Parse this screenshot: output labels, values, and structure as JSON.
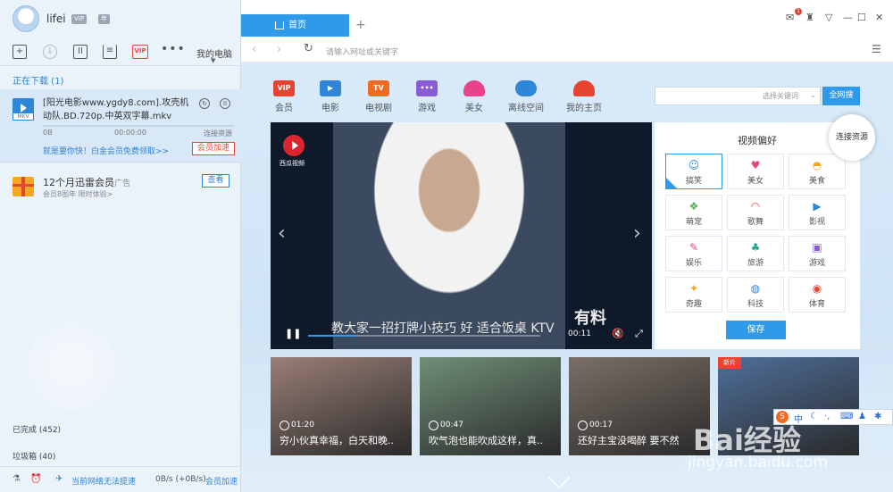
{
  "user": {
    "name": "lifei",
    "badges": [
      "VIP",
      "年"
    ]
  },
  "toolbar": {
    "vip": "VIP",
    "more": "•••",
    "my_pc": "我的电脑"
  },
  "downloads": {
    "header": "正在下载 (1)",
    "task": {
      "file_ext": "MKV",
      "file_name": "[阳光电影www.ygdy8.com].攻壳机动队.BD.720p.中英双字幕.mkv",
      "size": "0B",
      "time": "00:00:00",
      "status": "连接资源",
      "progress": 0,
      "promo": "就是要你快！白金会员免费领取>>",
      "accel_label": "会员加速"
    },
    "ad": {
      "title": "12个月迅雷会员",
      "tag": "- 广告",
      "subtitle": "会员8图年 限时体验>",
      "button": "查看"
    },
    "completed": "已完成 (452)",
    "trash": "垃圾箱 (40)"
  },
  "statusbar": {
    "net_warning": "当前网络无法提速",
    "speed": "0B/s (+0B/s)",
    "vip_speed": "会员加速"
  },
  "browser": {
    "tab_label": "首页",
    "add_tab": "+",
    "notification_count": "1",
    "address_placeholder": "请输入网址或关键字",
    "categories": [
      {
        "label": "会员",
        "icon": "VIP",
        "color": "#e8432f"
      },
      {
        "label": "电影",
        "icon": "▶",
        "color": "#2f85d8"
      },
      {
        "label": "电视剧",
        "icon": "TV",
        "color": "#f06a23"
      },
      {
        "label": "游戏",
        "icon": "•••",
        "color": "#8a5bd6"
      },
      {
        "label": "美女",
        "icon": "",
        "color": "#e8438a"
      },
      {
        "label": "离线空间",
        "icon": "",
        "color": "#2f85d8"
      },
      {
        "label": "我的主页",
        "icon": "",
        "color": "#e8432f"
      }
    ],
    "search": {
      "scope": "选择关键词",
      "button": "全网搜"
    },
    "player": {
      "brand": "西瓜视频",
      "caption": "教大家一招打牌小技巧 好 适合饭桌 KTV",
      "watermark": "有料",
      "time": "00:11",
      "progress": 0.2
    },
    "prefs": {
      "title": "视频偏好",
      "items": [
        {
          "label": "搞笑",
          "icon": "☺",
          "color": "#2f85d8",
          "selected": true
        },
        {
          "label": "美女",
          "icon": "♥",
          "color": "#e8438a",
          "selected": false
        },
        {
          "label": "美食",
          "icon": "◓",
          "color": "#f5a623",
          "selected": false
        },
        {
          "label": "萌宠",
          "icon": "❖",
          "color": "#4cb050",
          "selected": false
        },
        {
          "label": "歌舞",
          "icon": "◠",
          "color": "#e8432f",
          "selected": false
        },
        {
          "label": "影视",
          "icon": "▶",
          "color": "#2f85d8",
          "selected": false
        },
        {
          "label": "娱乐",
          "icon": "✎",
          "color": "#e8438a",
          "selected": false
        },
        {
          "label": "旅游",
          "icon": "♣",
          "color": "#2aa88a",
          "selected": false
        },
        {
          "label": "游戏",
          "icon": "▣",
          "color": "#8a5bd6",
          "selected": false
        },
        {
          "label": "奇趣",
          "icon": "✦",
          "color": "#f5a623",
          "selected": false
        },
        {
          "label": "科技",
          "icon": "◍",
          "color": "#2f85d8",
          "selected": false
        },
        {
          "label": "体育",
          "icon": "◉",
          "color": "#e8432f",
          "selected": false
        }
      ],
      "save": "保存"
    },
    "connect": "连接资源",
    "videos": [
      {
        "duration": "01:20",
        "title": "穷小伙真幸福，白天和晚..",
        "tone": "#9a7f76"
      },
      {
        "duration": "00:47",
        "title": "吹气泡也能吹成这样，真..",
        "tone": "#6f8f78"
      },
      {
        "duration": "00:17",
        "title": "还好主宝没喝醉 要不然",
        "tone": "#7b6f66"
      },
      {
        "duration": "",
        "title": "",
        "tone": "#4e6f9a",
        "badge": "新片"
      }
    ]
  },
  "overlay": {
    "ime_logo": "S",
    "ime_mode": "中",
    "watermark": "Bai经验",
    "watermark_url": "jingyan.baidu.com"
  }
}
